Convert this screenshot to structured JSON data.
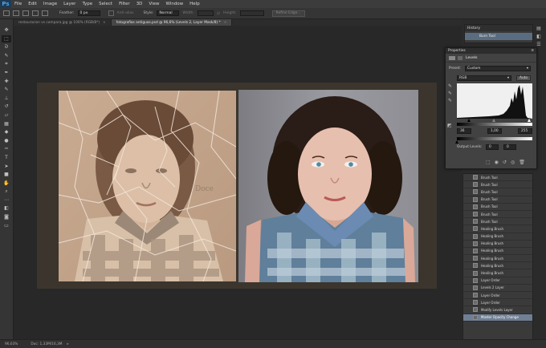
{
  "app": {
    "logo": "Ps"
  },
  "menu": [
    "File",
    "Edit",
    "Image",
    "Layer",
    "Type",
    "Select",
    "Filter",
    "3D",
    "View",
    "Window",
    "Help"
  ],
  "options": {
    "feather_label": "Feather:",
    "feather_value": "0 px",
    "antialias_label": "Anti-alias",
    "style_label": "Style:",
    "style_value": "Normal",
    "width_label": "Width:",
    "height_label": "Height:",
    "refine_edge": "Refine Edge..."
  },
  "tabs": [
    {
      "label": "restauracion vs compara.jpg @ 100% (RGB/8*)",
      "active": false
    },
    {
      "label": "fotografias antiguas.psd @ 96,6% (Levels 2, Layer Mask/8) *",
      "active": true
    }
  ],
  "tools": [
    "move-tool-icon",
    "marquee-tool-icon",
    "lasso-tool-icon",
    "quick-select-icon",
    "crop-tool-icon",
    "eyedropper-icon",
    "healing-brush-icon",
    "brush-tool-icon",
    "clone-stamp-icon",
    "history-brush-icon",
    "eraser-icon",
    "gradient-icon",
    "blur-icon",
    "dodge-icon",
    "pen-tool-icon",
    "type-tool-icon",
    "path-select-icon",
    "shape-tool-icon",
    "hand-tool-icon",
    "zoom-tool-icon",
    "more-tools-icon",
    "color-swatch-icon",
    "quick-mask-icon",
    "screen-mode-icon"
  ],
  "history_top": {
    "title": "History",
    "state": "Burn Tool"
  },
  "properties": {
    "title": "Properties",
    "panel": "Levels",
    "preset_label": "Preset:",
    "preset_value": "Custom",
    "channel": "RGB",
    "auto": "Auto",
    "input_black": "36",
    "input_gamma": "1,00",
    "input_white": "255",
    "output_label": "Output Levels:",
    "output_black": "0",
    "output_white": "0"
  },
  "history": [
    "Brush Tool",
    "Brush Tool",
    "Brush Tool",
    "Brush Tool",
    "Brush Tool",
    "Brush Tool",
    "Brush Tool",
    "Healing Brush",
    "Healing Brush",
    "Healing Brush",
    "Healing Brush",
    "Healing Brush",
    "Healing Brush",
    "Healing Brush",
    "Layer Order",
    "Levels 2 Layer",
    "Layer Order",
    "Layer Order",
    "Modify Levels Layer",
    "Master Opacity Change"
  ],
  "history_selected": 19,
  "status": {
    "zoom": "96,63%",
    "doc": "Doc: 1,33M/16,3M"
  }
}
